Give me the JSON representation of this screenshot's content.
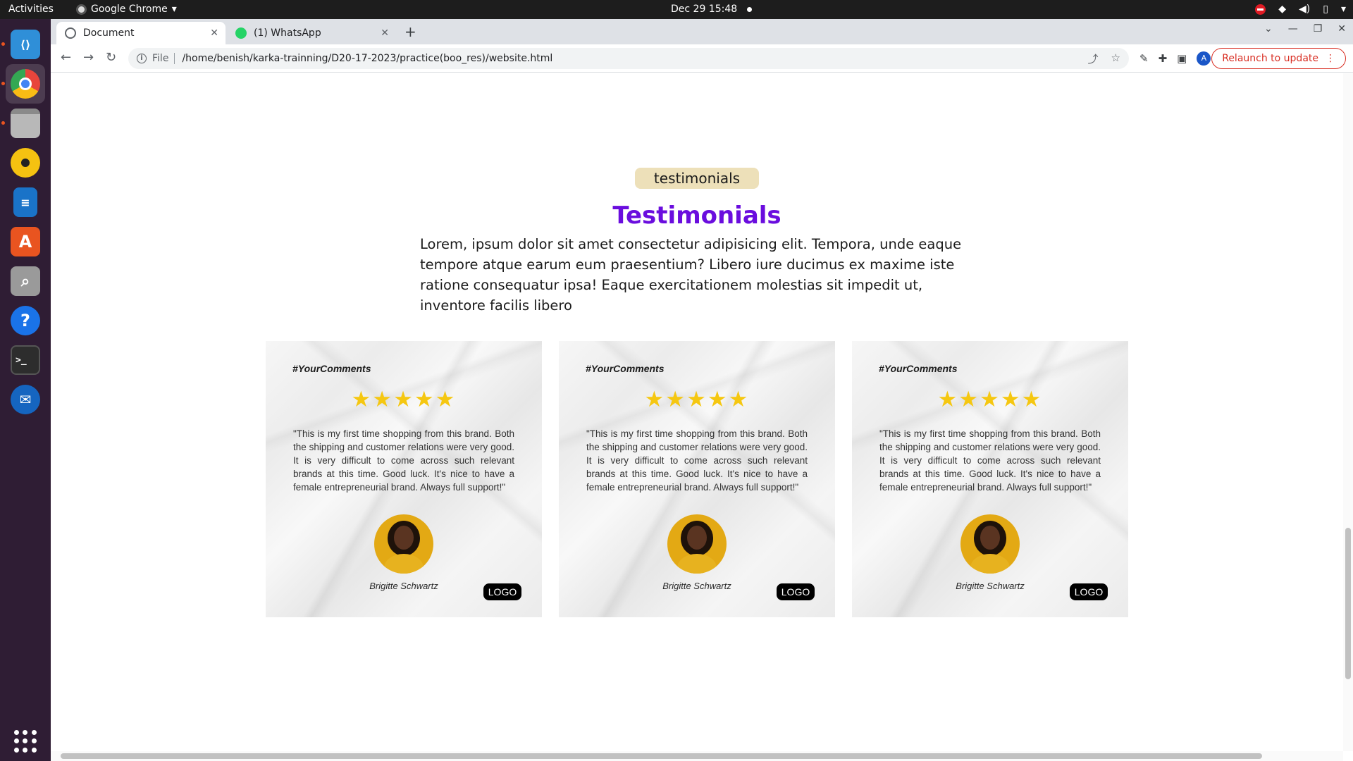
{
  "topbar": {
    "activities": "Activities",
    "app_name": "Google Chrome",
    "datetime": "Dec 29  15:48"
  },
  "dock": {
    "items": [
      {
        "name": "vscode",
        "icon": "vscode-icon",
        "color": "#2f8fd8"
      },
      {
        "name": "chrome",
        "icon": "chrome-icon",
        "color": "#e8453c"
      },
      {
        "name": "files",
        "icon": "folder-icon",
        "color": "#8c8c8c"
      },
      {
        "name": "rhythmbox",
        "icon": "rhythmbox-icon",
        "color": "#f5c211"
      },
      {
        "name": "writer",
        "icon": "document-icon",
        "color": "#1a73c8"
      },
      {
        "name": "software",
        "icon": "app-store-icon",
        "color": "#e95420"
      },
      {
        "name": "image-viewer",
        "icon": "magnifier-icon",
        "color": "#9a9a9a"
      },
      {
        "name": "help",
        "icon": "help-icon",
        "color": "#1a73e8"
      },
      {
        "name": "terminal",
        "icon": "terminal-icon",
        "color": "#2d2d2d"
      },
      {
        "name": "thunderbird",
        "icon": "thunderbird-icon",
        "color": "#1565c0"
      }
    ]
  },
  "browser": {
    "tabs": [
      {
        "label": "Document",
        "active": true
      },
      {
        "label": "(1) WhatsApp",
        "active": false
      }
    ],
    "address": {
      "scheme": "File",
      "url": "/home/benish/karka-trainning/D20-17-2023/practice(boo_res)/website.html"
    },
    "profile_initial": "A",
    "relaunch_label": "Relaunch to update"
  },
  "page": {
    "pill": "testimonials",
    "heading": "Testimonials",
    "lead": "Lorem, ipsum dolor sit amet consectetur adipisicing elit. Tempora, unde eaque tempore atque earum eum praesentium? Libero iure ducimus ex maxime iste ratione consequatur ipsa! Eaque exercitationem molestias sit impedit ut, inventore facilis libero",
    "cards": [
      {
        "tag": "#YourComments",
        "rating": 5,
        "quote": "\"This is my first time shopping from this brand. Both the shipping and customer relations were very good. It is very difficult to come across such relevant brands at this time. Good luck. It's nice to have a female entrepreneurial brand. Always full support!\"",
        "name": "Brigitte Schwartz",
        "logo": "LOGO"
      },
      {
        "tag": "#YourComments",
        "rating": 5,
        "quote": "\"This is my first time shopping from this brand. Both the shipping and customer relations were very good. It is very difficult to come across such relevant brands at this time. Good luck. It's nice to have a female entrepreneurial brand. Always full support!\"",
        "name": "Brigitte Schwartz",
        "logo": "LOGO"
      },
      {
        "tag": "#YourComments",
        "rating": 5,
        "quote": "\"This is my first time shopping from this brand. Both the shipping and customer relations were very good. It is very difficult to come across such relevant brands at this time. Good luck. It's nice to have a female entrepreneurial brand. Always full support!\"",
        "name": "Brigitte Schwartz",
        "logo": "LOGO"
      }
    ],
    "colors": {
      "heading": "#6a0dde",
      "pill_bg": "#ede0b9",
      "star": "#f5c711"
    }
  }
}
